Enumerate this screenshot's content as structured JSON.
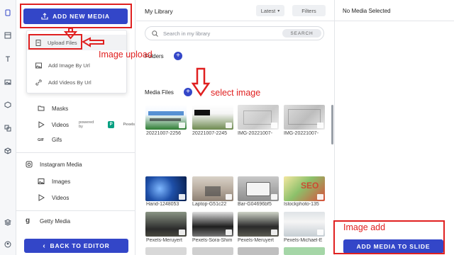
{
  "rail": {
    "icons": [
      "document-icon",
      "grid-icon",
      "text-icon",
      "image-icon",
      "cube-icon",
      "copy-icon",
      "box-icon",
      "layers-icon",
      "user-icon"
    ]
  },
  "panel": {
    "add_media_label": "ADD NEW MEDIA",
    "dropdown": {
      "items": [
        {
          "label": "Upload Files",
          "icon": "file-icon"
        },
        {
          "label": "Add Image By Url",
          "icon": "image-icon"
        },
        {
          "label": "Add Videos By Url",
          "icon": "link-icon"
        }
      ]
    },
    "items": {
      "masks": "Masks",
      "videos": "Videos",
      "videos_powered": "powered by",
      "pexels": "Pexels",
      "gif_icon": "GIF",
      "gifs": "Gifs",
      "instagram": "Instagram Media",
      "insta_images": "Images",
      "insta_videos": "Videos",
      "getty": "Getty Media"
    },
    "back_label": "BACK TO EDITOR"
  },
  "library": {
    "title": "My Library",
    "sort_label": "Latest",
    "filters_label": "Filters",
    "search_placeholder": "Search in my library",
    "search_button": "SEARCH",
    "folders_label": "Folders",
    "media_files_label": "Media Files",
    "row1": [
      {
        "label": "20221007-2256"
      },
      {
        "label": "20221007-2245"
      },
      {
        "label": "IMG-20221007-"
      },
      {
        "label": "IMG-20221007-"
      }
    ],
    "row2": [
      {
        "label": "Hand-1248053"
      },
      {
        "label": "Laptop-G51c22"
      },
      {
        "label": "Bar-G04696bf5"
      },
      {
        "label": "Istockphoto-135"
      }
    ],
    "row3": [
      {
        "label": "Pexels-Meruyert"
      },
      {
        "label": "Pexels-Sora-Shim"
      },
      {
        "label": "Pexels-Meruyert"
      },
      {
        "label": "Pexels-Michael-E"
      }
    ]
  },
  "right_panel": {
    "title": "No Media Selected",
    "add_button": "ADD MEDIA TO SLIDE"
  },
  "annotations": {
    "image_upload": "Image upload",
    "select_image": "select image",
    "image_add": "Image add",
    "color": "#e02020"
  },
  "colors": {
    "accent": "#3346c8"
  }
}
